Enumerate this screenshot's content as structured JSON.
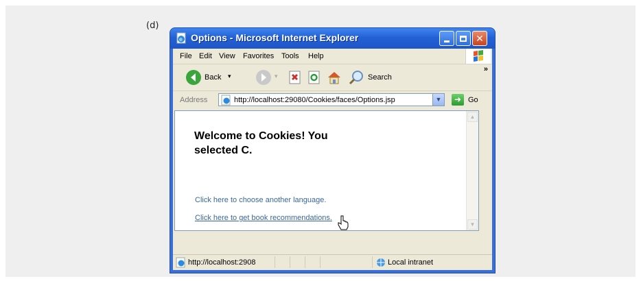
{
  "figure_label": "(d)",
  "window": {
    "title": "Options - Microsoft Internet Explorer"
  },
  "menu": [
    "File",
    "Edit",
    "View",
    "Favorites",
    "Tools",
    "Help"
  ],
  "toolbar": {
    "back_label": "Back",
    "search_label": "Search",
    "chevron": "»"
  },
  "address": {
    "label": "Address",
    "url": "http://localhost:29080/Cookies/faces/Options.jsp",
    "go_label": "Go"
  },
  "page": {
    "heading": "Welcome to Cookies! You selected C.",
    "link_language": "Click here to choose another language.",
    "link_recommendations": "Click here to get book recommendations."
  },
  "status": {
    "url": "http://localhost:2908",
    "zone": "Local intranet"
  },
  "colors": {
    "titlebar": "#2461d6",
    "link": "#3767a0",
    "chrome": "#ece9d8"
  },
  "icons": [
    "ie-page-icon",
    "minimize-icon",
    "maximize-icon",
    "close-icon",
    "windows-flag-icon",
    "back-arrow-icon",
    "forward-arrow-icon",
    "stop-icon",
    "refresh-icon",
    "home-icon",
    "search-icon",
    "go-arrow-icon",
    "hand-cursor-icon",
    "intranet-icon"
  ]
}
